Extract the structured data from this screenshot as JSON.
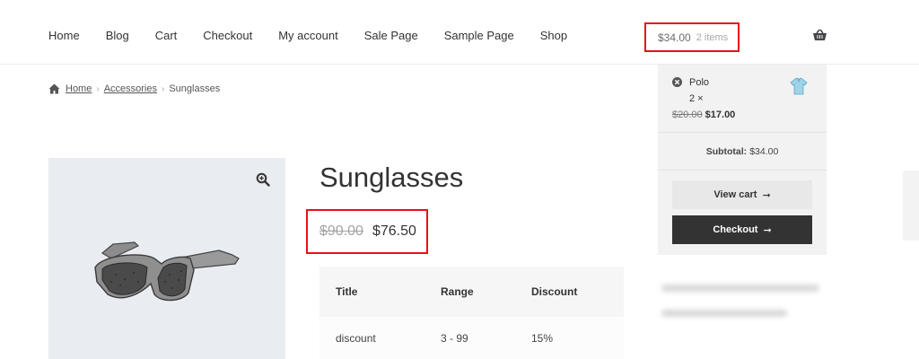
{
  "nav": {
    "items": [
      "Home",
      "Blog",
      "Cart",
      "Checkout",
      "My account",
      "Sale Page",
      "Sample Page",
      "Shop"
    ]
  },
  "header_cart": {
    "total": "$34.00",
    "count": "2 items",
    "basket_icon": "basket-icon"
  },
  "breadcrumb": {
    "icon": "home-icon",
    "items": [
      "Home",
      "Accessories",
      "Sunglasses"
    ]
  },
  "product": {
    "title": "Sunglasses",
    "price_old": "$90.00",
    "price_new": "$76.50",
    "image_icon": "sunglasses-image",
    "zoom_icon": "zoom-icon"
  },
  "discount_table": {
    "headers": [
      "Title",
      "Range",
      "Discount"
    ],
    "rows": [
      [
        "discount",
        "3 - 99",
        "15%"
      ]
    ]
  },
  "mini_cart": {
    "item": {
      "name": "Polo",
      "qty": "2 ×",
      "price_old": "$20.00",
      "price_new": "$17.00"
    },
    "subtotal_label": "Subtotal:",
    "subtotal_value": "$34.00",
    "view_cart": "View cart",
    "checkout": "Checkout"
  },
  "colors": {
    "highlight": "#e8101b",
    "checkout_bg": "#333333",
    "image_bg": "#e9edf1"
  }
}
